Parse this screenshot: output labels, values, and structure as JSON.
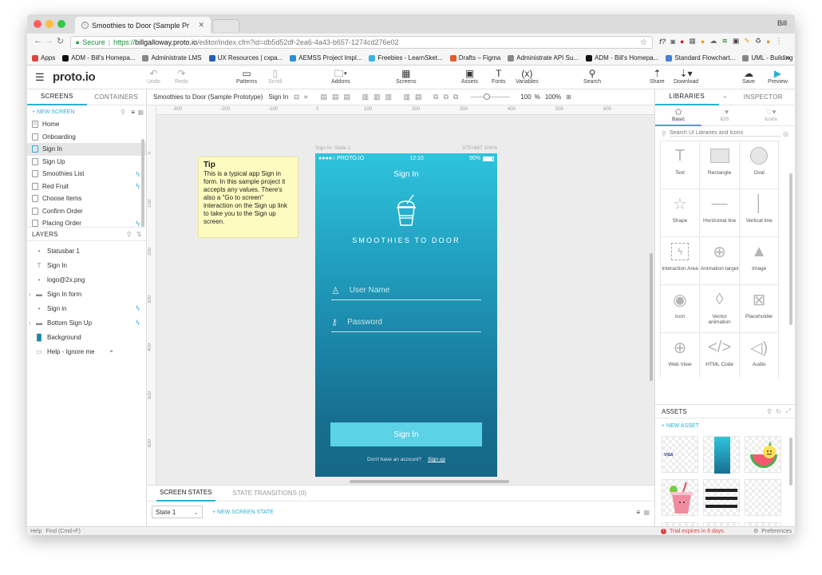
{
  "browser": {
    "tab_title": "Smoothies to Door (Sample Pr",
    "profile_name": "Bill",
    "url": {
      "secure_label": "Secure",
      "scheme": "https://",
      "host": "billgalloway.proto.io",
      "path": "/editor/index.cfm?id=db5d52df-2ea6-4a43-b657-1274cd276e02"
    },
    "bookmarks": [
      {
        "label": "Apps",
        "color": "#d44"
      },
      {
        "label": "ADM - Bill's Homepa...",
        "color": "#111"
      },
      {
        "label": "Administrate LMS",
        "color": "#888"
      },
      {
        "label": "UX Resources | cxpa...",
        "color": "#2a5db0"
      },
      {
        "label": "AEMSS Project Impl...",
        "color": "#2a8fd4"
      },
      {
        "label": "Freebies - LearnSket...",
        "color": "#3cb4e6"
      },
      {
        "label": "Drafts – Figma",
        "color": "#e35a2f"
      },
      {
        "label": "Administrate API Su...",
        "color": "#888"
      },
      {
        "label": "ADM - Bill's Homepa...",
        "color": "#111"
      },
      {
        "label": "Standard Flowchart...",
        "color": "#4a7fd4"
      },
      {
        "label": "UML - Building Blocks",
        "color": "#888"
      }
    ],
    "more_label": "»"
  },
  "toolbar": {
    "logo": "proto.io",
    "undo": "Undo",
    "redo": "Redo",
    "patterns": "Patterns",
    "scroll": "Scroll",
    "addons": "Addons",
    "screens": "Screens",
    "assets": "Assets",
    "fonts": "Fonts",
    "variables": "Variables",
    "variables_icon": "(x)",
    "search": "Search",
    "share": "Share",
    "download": "Download",
    "save": "Save",
    "preview": "Preview"
  },
  "left_panel": {
    "tabs": [
      "SCREENS",
      "CONTAINERS"
    ],
    "new_screen": "+ NEW SCREEN",
    "screens": [
      {
        "label": "Home",
        "interaction": false,
        "selected": false
      },
      {
        "label": "Onboarding",
        "interaction": false,
        "selected": false
      },
      {
        "label": "Sign In",
        "interaction": false,
        "selected": true
      },
      {
        "label": "Sign Up",
        "interaction": false,
        "selected": false
      },
      {
        "label": "Smoothies List",
        "interaction": true,
        "selected": false
      },
      {
        "label": "Red Fruit",
        "interaction": true,
        "selected": false
      },
      {
        "label": "Choose Items",
        "interaction": false,
        "selected": false
      },
      {
        "label": "Confirm Order",
        "interaction": false,
        "selected": false
      },
      {
        "label": "Placing Order",
        "interaction": true,
        "selected": false
      }
    ],
    "layers_title": "LAYERS",
    "layers": [
      {
        "label": "Statusbar 1",
        "icon": "apple-icon",
        "interaction": false
      },
      {
        "label": "Sign In",
        "icon": "text-icon",
        "interaction": false
      },
      {
        "label": "logo@2x.png",
        "icon": "image-icon",
        "interaction": false
      },
      {
        "label": "Sign In form",
        "icon": "folder-icon",
        "interaction": false
      },
      {
        "label": "Sign in",
        "icon": "apple-icon",
        "interaction": true
      },
      {
        "label": "Bottom Sign Up",
        "icon": "folder-icon",
        "interaction": true
      },
      {
        "label": "Background",
        "icon": "rectangle-icon",
        "interaction": false
      },
      {
        "label": "Help - Ignore me",
        "icon": "rectangle-icon",
        "interaction": false
      }
    ]
  },
  "canvas": {
    "project_title": "Smoothies to Door (Sample Prototype)",
    "screen_name": "Sign In",
    "zoom_value": "100",
    "zoom_unit": "%",
    "zoom_fit": "100%",
    "ruler_top": [
      "-300",
      "-200",
      "-100",
      "0",
      "100",
      "200",
      "300",
      "400",
      "500",
      "600"
    ],
    "ruler_left": [
      "0",
      "100",
      "200",
      "300",
      "400",
      "500",
      "600"
    ],
    "tip_title": "Tip",
    "tip_body": "This is a typical app Sign in form. In this sample project it accepts any values. There's also a \"Go to screen\" interaction on the Sign up link to take you to the Sign up screen.",
    "phone_label": "Sign In: State 1",
    "phone_dims": "375×667  100%",
    "phone": {
      "carrier": "●●●●○ PROTO.IO",
      "time": "12:10",
      "battery": "90%",
      "title": "Sign In",
      "brand": "SMOOTHIES TO DOOR",
      "username_placeholder": "User Name",
      "password_placeholder": "Password",
      "signin_button": "Sign In",
      "no_account": "Don't have an account?",
      "signup_link": "Sign up"
    }
  },
  "states": {
    "tabs": [
      "SCREEN STATES",
      "STATE TRANSITIONS (0)"
    ],
    "current_state": "State 1",
    "new_state": "+ NEW SCREEN STATE"
  },
  "right_panel": {
    "tabs": [
      "LIBRARIES",
      "INSPECTOR"
    ],
    "subtabs": [
      "Basic",
      "iOS",
      "Icons"
    ],
    "search_placeholder": "Search UI Libraries and Icons",
    "library_items": [
      "Text",
      "Rectangle",
      "Oval",
      "Shape",
      "Horizontal line",
      "Vertical line",
      "Interaction Area",
      "Animation target",
      "Image",
      "Icon",
      "Vector animation",
      "Placeholder",
      "Web View",
      "HTML Code",
      "Audio"
    ],
    "assets_title": "ASSETS",
    "new_asset": "+ NEW ASSET",
    "asset_visa": "VISA"
  },
  "status_bar": {
    "help": "Help",
    "find": "Find (Cmd+F)",
    "trial": "Trial expires in 6 days",
    "preferences": "Preferences"
  },
  "colors": {
    "accent": "#2bb0d4",
    "trial": "#e04040"
  }
}
